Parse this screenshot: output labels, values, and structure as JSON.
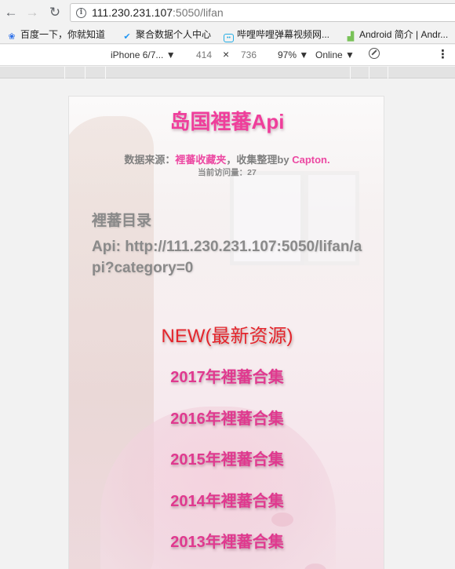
{
  "browser": {
    "url_host": "111.230.231.107",
    "url_rest": ":5050/lifan",
    "nav": {
      "back": "←",
      "forward": "→",
      "reload": "↻",
      "info": "i"
    }
  },
  "bookmarks": [
    {
      "icon": "paw-icon",
      "glyph": "❀",
      "label": "百度一下，你就知道"
    },
    {
      "icon": "check-icon",
      "glyph": "✔",
      "label": "聚合数据个人中心"
    },
    {
      "icon": "tv-icon",
      "glyph": "••",
      "label": "哔哩哔哩弹幕视频网..."
    },
    {
      "icon": "android-icon",
      "glyph": "▟",
      "label": "Android 简介 | Andr..."
    }
  ],
  "devtools": {
    "device": "iPhone 6/7... ▼",
    "width": "414",
    "times": "×",
    "height": "736",
    "zoom": "97% ▼",
    "network": "Online ▼",
    "more": "⋮"
  },
  "page": {
    "title": "岛国裡蕃Api",
    "source_label": "数据来源：",
    "source_link": "裡蕃收藏夹",
    "source_middle": "，收集整理by",
    "source_author": "Capton.",
    "visits": "当前访问量：27",
    "dir_title": "裡蕃目录",
    "api_text": "Api: http://111.230.231.107:5050/lifan/api?category=0",
    "new_link": "NEW(最新资源)",
    "years": [
      "2017年裡蕃合集",
      "2016年裡蕃合集",
      "2015年裡蕃合集",
      "2014年裡蕃合集",
      "2013年裡蕃合集"
    ]
  },
  "colors": {
    "title_pink": "#ef3e9b",
    "link_pink": "#e0398f",
    "new_red": "#e4252c",
    "gray_text": "#8a8a8a"
  }
}
